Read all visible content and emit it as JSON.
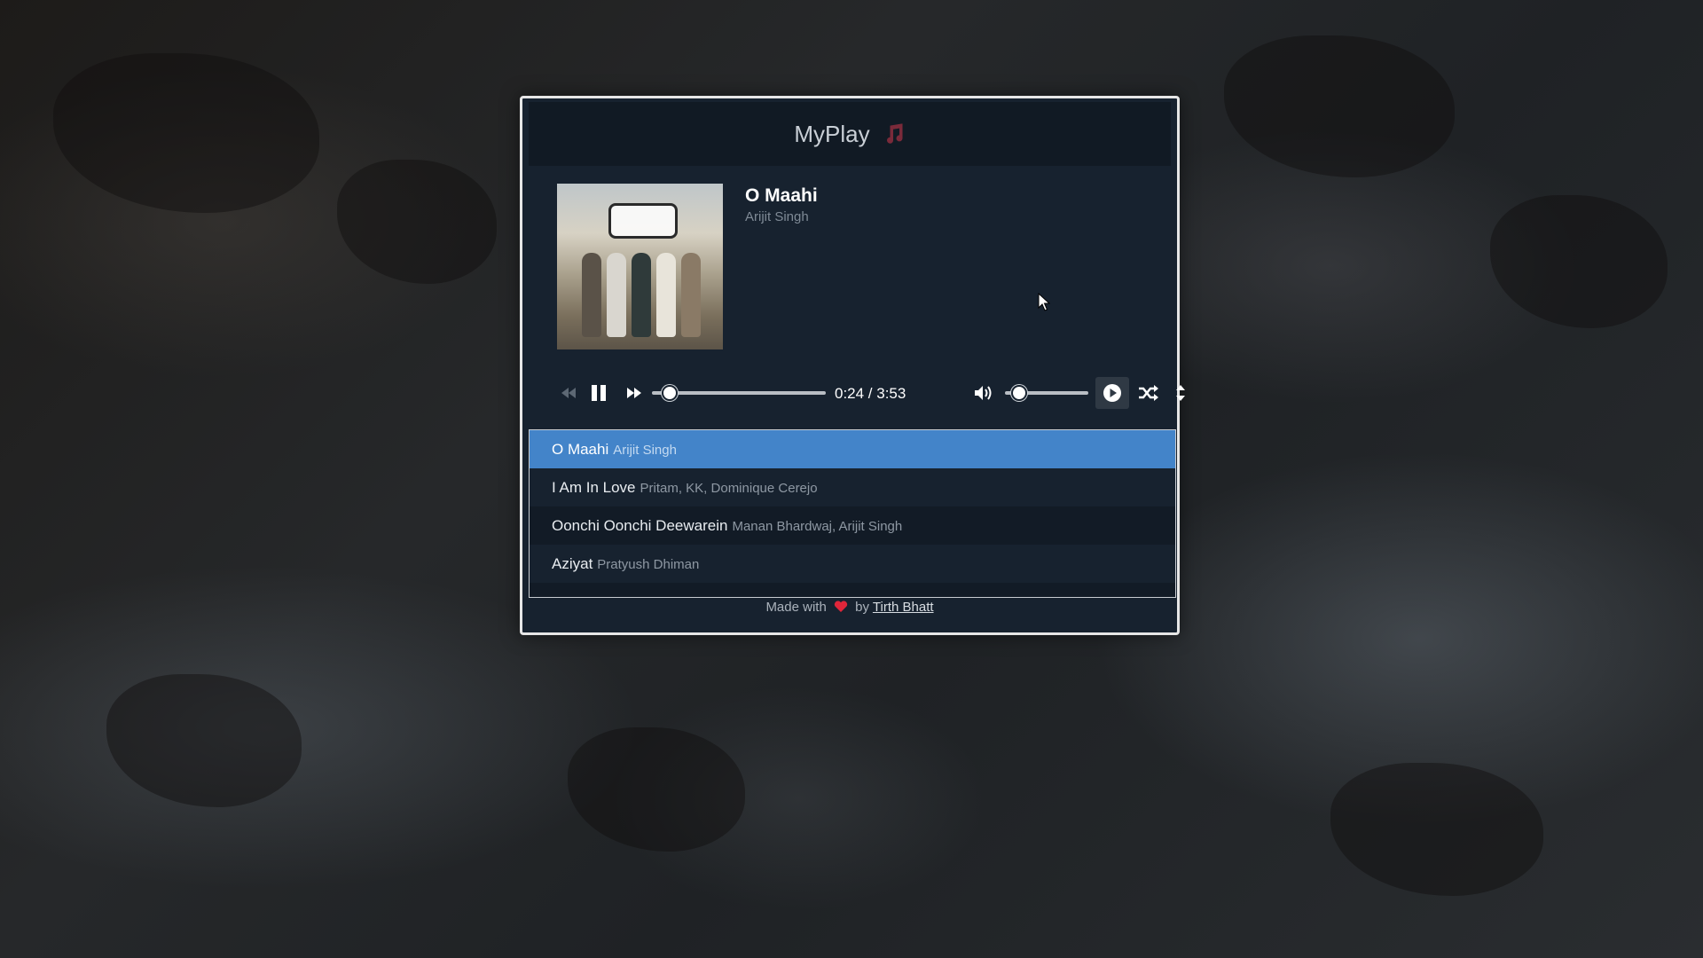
{
  "app": {
    "title": "MyPlay",
    "icon": "music-note-icon",
    "accent_color": "#4384c9",
    "header_note_color": "#7a2a3a"
  },
  "now_playing": {
    "title": "O Maahi",
    "artist": "Arijit Singh",
    "album_art": "dunki-album-cover",
    "progress_fraction": 0.103,
    "volume_fraction": 0.17
  },
  "controls": {
    "previous": "rewind-icon",
    "play_pause": "pause-icon",
    "next": "fast-forward-icon",
    "time_text": "0:24 / 3:53",
    "volume": "volume-icon",
    "loop": "loop-play-icon",
    "shuffle": "shuffle-icon",
    "collapse": "sort-icon"
  },
  "playlist": [
    {
      "title": "O Maahi",
      "artist": "Arijit Singh"
    },
    {
      "title": "I Am In Love",
      "artist": "Pritam, KK, Dominique Cerejo"
    },
    {
      "title": "Oonchi Oonchi Deewarein",
      "artist": "Manan Bhardwaj, Arijit Singh"
    },
    {
      "title": "Aziyat",
      "artist": "Pratyush Dhiman"
    }
  ],
  "footer": {
    "prefix": "Made with",
    "by": "by",
    "author": "Tirth Bhatt",
    "heart_color": "#e0263a"
  }
}
